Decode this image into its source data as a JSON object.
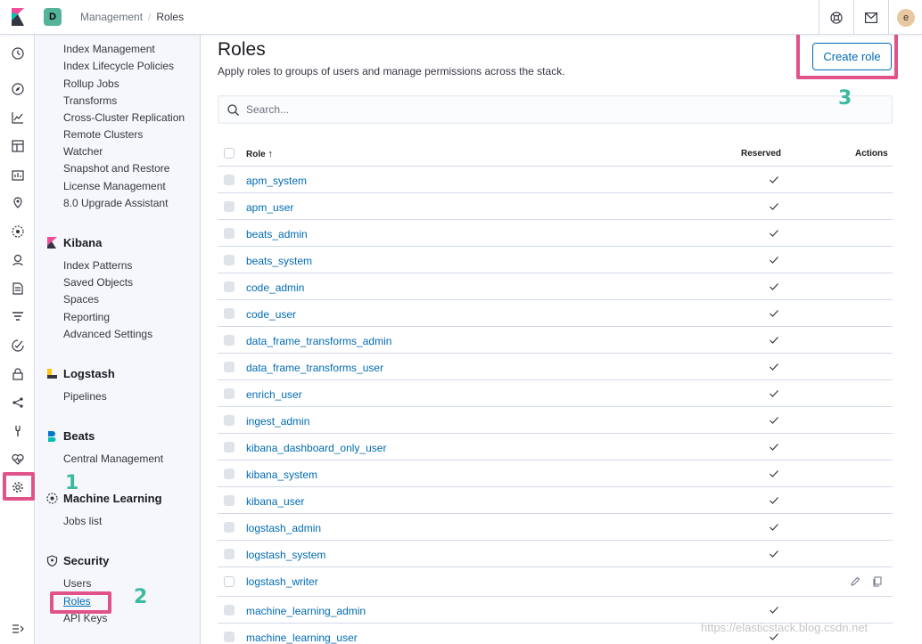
{
  "topbar": {
    "space_letter": "D",
    "breadcrumbs": [
      "Management",
      "/",
      "Roles"
    ],
    "avatar_letter": "e"
  },
  "sidebar": {
    "elasticsearch_links": [
      "Index Management",
      "Index Lifecycle Policies",
      "Rollup Jobs",
      "Transforms",
      "Cross-Cluster Replication",
      "Remote Clusters",
      "Watcher",
      "Snapshot and Restore",
      "License Management",
      "8.0 Upgrade Assistant"
    ],
    "kibana": {
      "title": "Kibana",
      "links": [
        "Index Patterns",
        "Saved Objects",
        "Spaces",
        "Reporting",
        "Advanced Settings"
      ]
    },
    "logstash": {
      "title": "Logstash",
      "links": [
        "Pipelines"
      ]
    },
    "beats": {
      "title": "Beats",
      "links": [
        "Central Management"
      ]
    },
    "ml": {
      "title": "Machine Learning",
      "links": [
        "Jobs list"
      ]
    },
    "security": {
      "title": "Security",
      "links": [
        "Users",
        "Roles",
        "API Keys"
      ]
    }
  },
  "main": {
    "title": "Roles",
    "description": "Apply roles to groups of users and manage permissions across the stack.",
    "create_button": "Create role",
    "search_placeholder": "Search..."
  },
  "table": {
    "columns": {
      "role": "Role",
      "reserved": "Reserved",
      "actions": "Actions"
    },
    "sort_indicator": "↑",
    "rows": [
      {
        "name": "apm_system",
        "reserved": true
      },
      {
        "name": "apm_user",
        "reserved": true
      },
      {
        "name": "beats_admin",
        "reserved": true
      },
      {
        "name": "beats_system",
        "reserved": true
      },
      {
        "name": "code_admin",
        "reserved": true
      },
      {
        "name": "code_user",
        "reserved": true
      },
      {
        "name": "data_frame_transforms_admin",
        "reserved": true
      },
      {
        "name": "data_frame_transforms_user",
        "reserved": true
      },
      {
        "name": "enrich_user",
        "reserved": true
      },
      {
        "name": "ingest_admin",
        "reserved": true
      },
      {
        "name": "kibana_dashboard_only_user",
        "reserved": true
      },
      {
        "name": "kibana_system",
        "reserved": true
      },
      {
        "name": "kibana_user",
        "reserved": true
      },
      {
        "name": "logstash_admin",
        "reserved": true
      },
      {
        "name": "logstash_system",
        "reserved": true
      },
      {
        "name": "logstash_writer",
        "reserved": false
      },
      {
        "name": "machine_learning_admin",
        "reserved": true
      },
      {
        "name": "machine_learning_user",
        "reserved": true
      }
    ]
  },
  "annotations": {
    "step1": "1",
    "step2": "2",
    "step3": "3"
  },
  "watermark": "https://elasticstack.blog.csdn.net",
  "colors": {
    "link": "#006bb4",
    "highlight": "#e0538a",
    "annotation": "#3cb9a0",
    "space_badge": "#54b399"
  }
}
